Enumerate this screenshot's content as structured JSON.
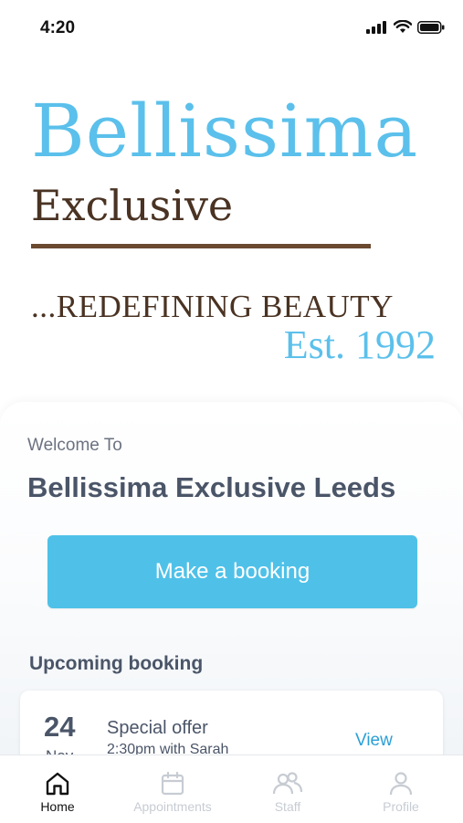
{
  "status_bar": {
    "time": "4:20"
  },
  "logo": {
    "line1": "Bellissima",
    "line2": "Exclusive",
    "tagline": "...REDEFINING BEAUTY",
    "established": "Est. 1992"
  },
  "welcome": {
    "label": "Welcome To",
    "salon_name": "Bellissima Exclusive Leeds"
  },
  "booking_button": {
    "label": "Make a booking"
  },
  "upcoming": {
    "heading": "Upcoming booking",
    "booking": {
      "day": "24",
      "month": "Nov",
      "title": "Special offer",
      "subtitle": "2:30pm with Sarah",
      "action": "View"
    }
  },
  "tabs": [
    {
      "label": "Home",
      "icon": "home-icon",
      "active": true
    },
    {
      "label": "Appointments",
      "icon": "calendar-icon",
      "active": false
    },
    {
      "label": "Staff",
      "icon": "staff-icon",
      "active": false
    },
    {
      "label": "Profile",
      "icon": "profile-icon",
      "active": false
    }
  ],
  "colors": {
    "brand_blue": "#5bc0eb",
    "brand_brown": "#4a3323",
    "button_blue": "#4fc1e8",
    "text_slate": "#4a5568",
    "link_blue": "#2a9fd6",
    "inactive_tab": "#c7ccd3"
  }
}
